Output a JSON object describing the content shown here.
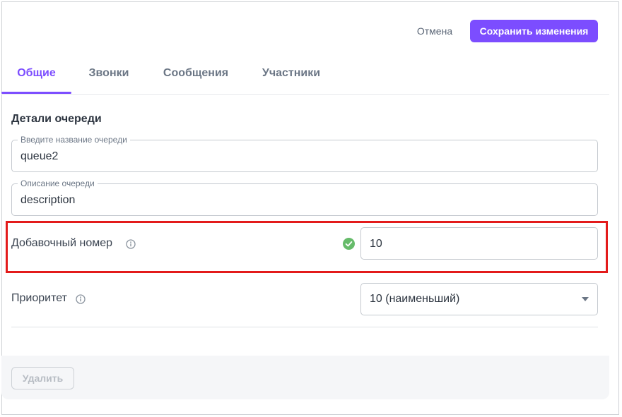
{
  "header": {
    "cancel_label": "Отмена",
    "save_label": "Сохранить изменения"
  },
  "tabs": [
    {
      "label": "Общие",
      "active": true
    },
    {
      "label": "Звонки",
      "active": false
    },
    {
      "label": "Сообщения",
      "active": false
    },
    {
      "label": "Участники",
      "active": false
    }
  ],
  "section": {
    "title": "Детали очереди"
  },
  "fields": {
    "queue_name": {
      "label": "Введите название очереди",
      "value": "queue2"
    },
    "description": {
      "label": "Описание очереди",
      "value": "description"
    },
    "extension": {
      "label": "Добавочный номер",
      "value": "10",
      "status": "valid"
    },
    "priority": {
      "label": "Приоритет",
      "value": "10 (наименьший)"
    }
  },
  "footer": {
    "delete_label": "Удалить"
  },
  "colors": {
    "accent": "#7c4dff",
    "highlight": "#e31b1b",
    "valid": "#66bb6a"
  },
  "icons": [
    "info-icon",
    "check-circle-icon",
    "chevron-down-icon"
  ]
}
